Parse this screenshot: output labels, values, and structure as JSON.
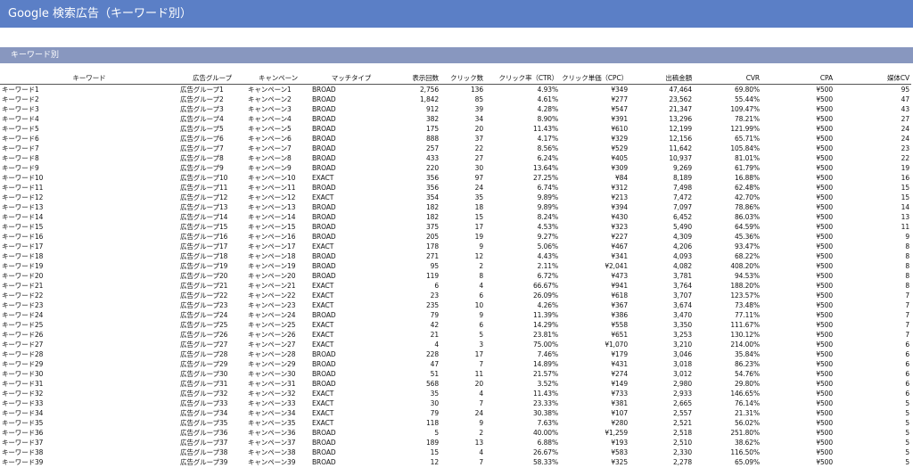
{
  "title": "Google 検索広告（キーワード別）",
  "section_title": "キーワード別",
  "columns": [
    "キーワード",
    "広告グループ",
    "キャンペーン",
    "マッチタイプ",
    "表示回数",
    "クリック数",
    "クリック率（CTR）",
    "クリック単価（CPC）",
    "出稿金額",
    "CVR",
    "CPA",
    "媒体CV"
  ],
  "rows": [
    [
      "キーワード1",
      "広告グループ1",
      "キャンペーン1",
      "BROAD",
      "2,756",
      "136",
      "4.93%",
      "¥349",
      "47,464",
      "69.80%",
      "¥500",
      "95"
    ],
    [
      "キーワード2",
      "広告グループ2",
      "キャンペーン2",
      "BROAD",
      "1,842",
      "85",
      "4.61%",
      "¥277",
      "23,562",
      "55.44%",
      "¥500",
      "47"
    ],
    [
      "キーワード3",
      "広告グループ3",
      "キャンペーン3",
      "BROAD",
      "912",
      "39",
      "4.28%",
      "¥547",
      "21,347",
      "109.47%",
      "¥500",
      "43"
    ],
    [
      "キーワード4",
      "広告グループ4",
      "キャンペーン4",
      "BROAD",
      "382",
      "34",
      "8.90%",
      "¥391",
      "13,296",
      "78.21%",
      "¥500",
      "27"
    ],
    [
      "キーワード5",
      "広告グループ5",
      "キャンペーン5",
      "BROAD",
      "175",
      "20",
      "11.43%",
      "¥610",
      "12,199",
      "121.99%",
      "¥500",
      "24"
    ],
    [
      "キーワード6",
      "広告グループ6",
      "キャンペーン6",
      "BROAD",
      "888",
      "37",
      "4.17%",
      "¥329",
      "12,156",
      "65.71%",
      "¥500",
      "24"
    ],
    [
      "キーワード7",
      "広告グループ7",
      "キャンペーン7",
      "BROAD",
      "257",
      "22",
      "8.56%",
      "¥529",
      "11,642",
      "105.84%",
      "¥500",
      "23"
    ],
    [
      "キーワード8",
      "広告グループ8",
      "キャンペーン8",
      "BROAD",
      "433",
      "27",
      "6.24%",
      "¥405",
      "10,937",
      "81.01%",
      "¥500",
      "22"
    ],
    [
      "キーワード9",
      "広告グループ9",
      "キャンペーン9",
      "BROAD",
      "220",
      "30",
      "13.64%",
      "¥309",
      "9,269",
      "61.79%",
      "¥500",
      "19"
    ],
    [
      "キーワード10",
      "広告グループ10",
      "キャンペーン10",
      "EXACT",
      "356",
      "97",
      "27.25%",
      "¥84",
      "8,189",
      "16.88%",
      "¥500",
      "16"
    ],
    [
      "キーワード11",
      "広告グループ11",
      "キャンペーン11",
      "BROAD",
      "356",
      "24",
      "6.74%",
      "¥312",
      "7,498",
      "62.48%",
      "¥500",
      "15"
    ],
    [
      "キーワード12",
      "広告グループ12",
      "キャンペーン12",
      "EXACT",
      "354",
      "35",
      "9.89%",
      "¥213",
      "7,472",
      "42.70%",
      "¥500",
      "15"
    ],
    [
      "キーワード13",
      "広告グループ13",
      "キャンペーン13",
      "BROAD",
      "182",
      "18",
      "9.89%",
      "¥394",
      "7,097",
      "78.86%",
      "¥500",
      "14"
    ],
    [
      "キーワード14",
      "広告グループ14",
      "キャンペーン14",
      "BROAD",
      "182",
      "15",
      "8.24%",
      "¥430",
      "6,452",
      "86.03%",
      "¥500",
      "13"
    ],
    [
      "キーワード15",
      "広告グループ15",
      "キャンペーン15",
      "BROAD",
      "375",
      "17",
      "4.53%",
      "¥323",
      "5,490",
      "64.59%",
      "¥500",
      "11"
    ],
    [
      "キーワード16",
      "広告グループ16",
      "キャンペーン16",
      "BROAD",
      "205",
      "19",
      "9.27%",
      "¥227",
      "4,309",
      "45.36%",
      "¥500",
      "9"
    ],
    [
      "キーワード17",
      "広告グループ17",
      "キャンペーン17",
      "EXACT",
      "178",
      "9",
      "5.06%",
      "¥467",
      "4,206",
      "93.47%",
      "¥500",
      "8"
    ],
    [
      "キーワード18",
      "広告グループ18",
      "キャンペーン18",
      "BROAD",
      "271",
      "12",
      "4.43%",
      "¥341",
      "4,093",
      "68.22%",
      "¥500",
      "8"
    ],
    [
      "キーワード19",
      "広告グループ19",
      "キャンペーン19",
      "BROAD",
      "95",
      "2",
      "2.11%",
      "¥2,041",
      "4,082",
      "408.20%",
      "¥500",
      "8"
    ],
    [
      "キーワード20",
      "広告グループ20",
      "キャンペーン20",
      "BROAD",
      "119",
      "8",
      "6.72%",
      "¥473",
      "3,781",
      "94.53%",
      "¥500",
      "8"
    ],
    [
      "キーワード21",
      "広告グループ21",
      "キャンペーン21",
      "EXACT",
      "6",
      "4",
      "66.67%",
      "¥941",
      "3,764",
      "188.20%",
      "¥500",
      "8"
    ],
    [
      "キーワード22",
      "広告グループ22",
      "キャンペーン22",
      "EXACT",
      "23",
      "6",
      "26.09%",
      "¥618",
      "3,707",
      "123.57%",
      "¥500",
      "7"
    ],
    [
      "キーワード23",
      "広告グループ23",
      "キャンペーン23",
      "EXACT",
      "235",
      "10",
      "4.26%",
      "¥367",
      "3,674",
      "73.48%",
      "¥500",
      "7"
    ],
    [
      "キーワード24",
      "広告グループ24",
      "キャンペーン24",
      "BROAD",
      "79",
      "9",
      "11.39%",
      "¥386",
      "3,470",
      "77.11%",
      "¥500",
      "7"
    ],
    [
      "キーワード25",
      "広告グループ25",
      "キャンペーン25",
      "EXACT",
      "42",
      "6",
      "14.29%",
      "¥558",
      "3,350",
      "111.67%",
      "¥500",
      "7"
    ],
    [
      "キーワード26",
      "広告グループ26",
      "キャンペーン26",
      "EXACT",
      "21",
      "5",
      "23.81%",
      "¥651",
      "3,253",
      "130.12%",
      "¥500",
      "7"
    ],
    [
      "キーワード27",
      "広告グループ27",
      "キャンペーン27",
      "EXACT",
      "4",
      "3",
      "75.00%",
      "¥1,070",
      "3,210",
      "214.00%",
      "¥500",
      "6"
    ],
    [
      "キーワード28",
      "広告グループ28",
      "キャンペーン28",
      "BROAD",
      "228",
      "17",
      "7.46%",
      "¥179",
      "3,046",
      "35.84%",
      "¥500",
      "6"
    ],
    [
      "キーワード29",
      "広告グループ29",
      "キャンペーン29",
      "BROAD",
      "47",
      "7",
      "14.89%",
      "¥431",
      "3,018",
      "86.23%",
      "¥500",
      "6"
    ],
    [
      "キーワード30",
      "広告グループ30",
      "キャンペーン30",
      "BROAD",
      "51",
      "11",
      "21.57%",
      "¥274",
      "3,012",
      "54.76%",
      "¥500",
      "6"
    ],
    [
      "キーワード31",
      "広告グループ31",
      "キャンペーン31",
      "BROAD",
      "568",
      "20",
      "3.52%",
      "¥149",
      "2,980",
      "29.80%",
      "¥500",
      "6"
    ],
    [
      "キーワード32",
      "広告グループ32",
      "キャンペーン32",
      "EXACT",
      "35",
      "4",
      "11.43%",
      "¥733",
      "2,933",
      "146.65%",
      "¥500",
      "6"
    ],
    [
      "キーワード33",
      "広告グループ33",
      "キャンペーン33",
      "EXACT",
      "30",
      "7",
      "23.33%",
      "¥381",
      "2,665",
      "76.14%",
      "¥500",
      "5"
    ],
    [
      "キーワード34",
      "広告グループ34",
      "キャンペーン34",
      "EXACT",
      "79",
      "24",
      "30.38%",
      "¥107",
      "2,557",
      "21.31%",
      "¥500",
      "5"
    ],
    [
      "キーワード35",
      "広告グループ35",
      "キャンペーン35",
      "EXACT",
      "118",
      "9",
      "7.63%",
      "¥280",
      "2,521",
      "56.02%",
      "¥500",
      "5"
    ],
    [
      "キーワード36",
      "広告グループ36",
      "キャンペーン36",
      "BROAD",
      "5",
      "2",
      "40.00%",
      "¥1,259",
      "2,518",
      "251.80%",
      "¥500",
      "5"
    ],
    [
      "キーワード37",
      "広告グループ37",
      "キャンペーン37",
      "BROAD",
      "189",
      "13",
      "6.88%",
      "¥193",
      "2,510",
      "38.62%",
      "¥500",
      "5"
    ],
    [
      "キーワード38",
      "広告グループ38",
      "キャンペーン38",
      "BROAD",
      "15",
      "4",
      "26.67%",
      "¥583",
      "2,330",
      "116.50%",
      "¥500",
      "5"
    ],
    [
      "キーワード39",
      "広告グループ39",
      "キャンペーン39",
      "BROAD",
      "12",
      "7",
      "58.33%",
      "¥325",
      "2,278",
      "65.09%",
      "¥500",
      "5"
    ]
  ]
}
